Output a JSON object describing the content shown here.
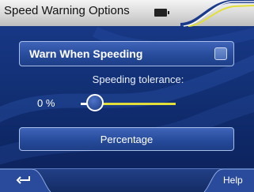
{
  "window": {
    "title": "Speed Warning Options",
    "status_icon": "battery-icon"
  },
  "main": {
    "warn_button": {
      "label": "Warn When Speeding",
      "checked": false
    },
    "tolerance": {
      "label": "Speeding tolerance:",
      "value_text": "0 %",
      "value_percent": 0
    },
    "percentage_button": {
      "label": "Percentage"
    }
  },
  "bottombar": {
    "back_icon": "back-arrow-icon",
    "help_label": "Help"
  },
  "colors": {
    "background": "#123075",
    "titlebar": "#d8d8d8",
    "accent_yellow": "#e3df3a",
    "button_fill": "#264a99",
    "button_border": "#a9bfe9"
  }
}
